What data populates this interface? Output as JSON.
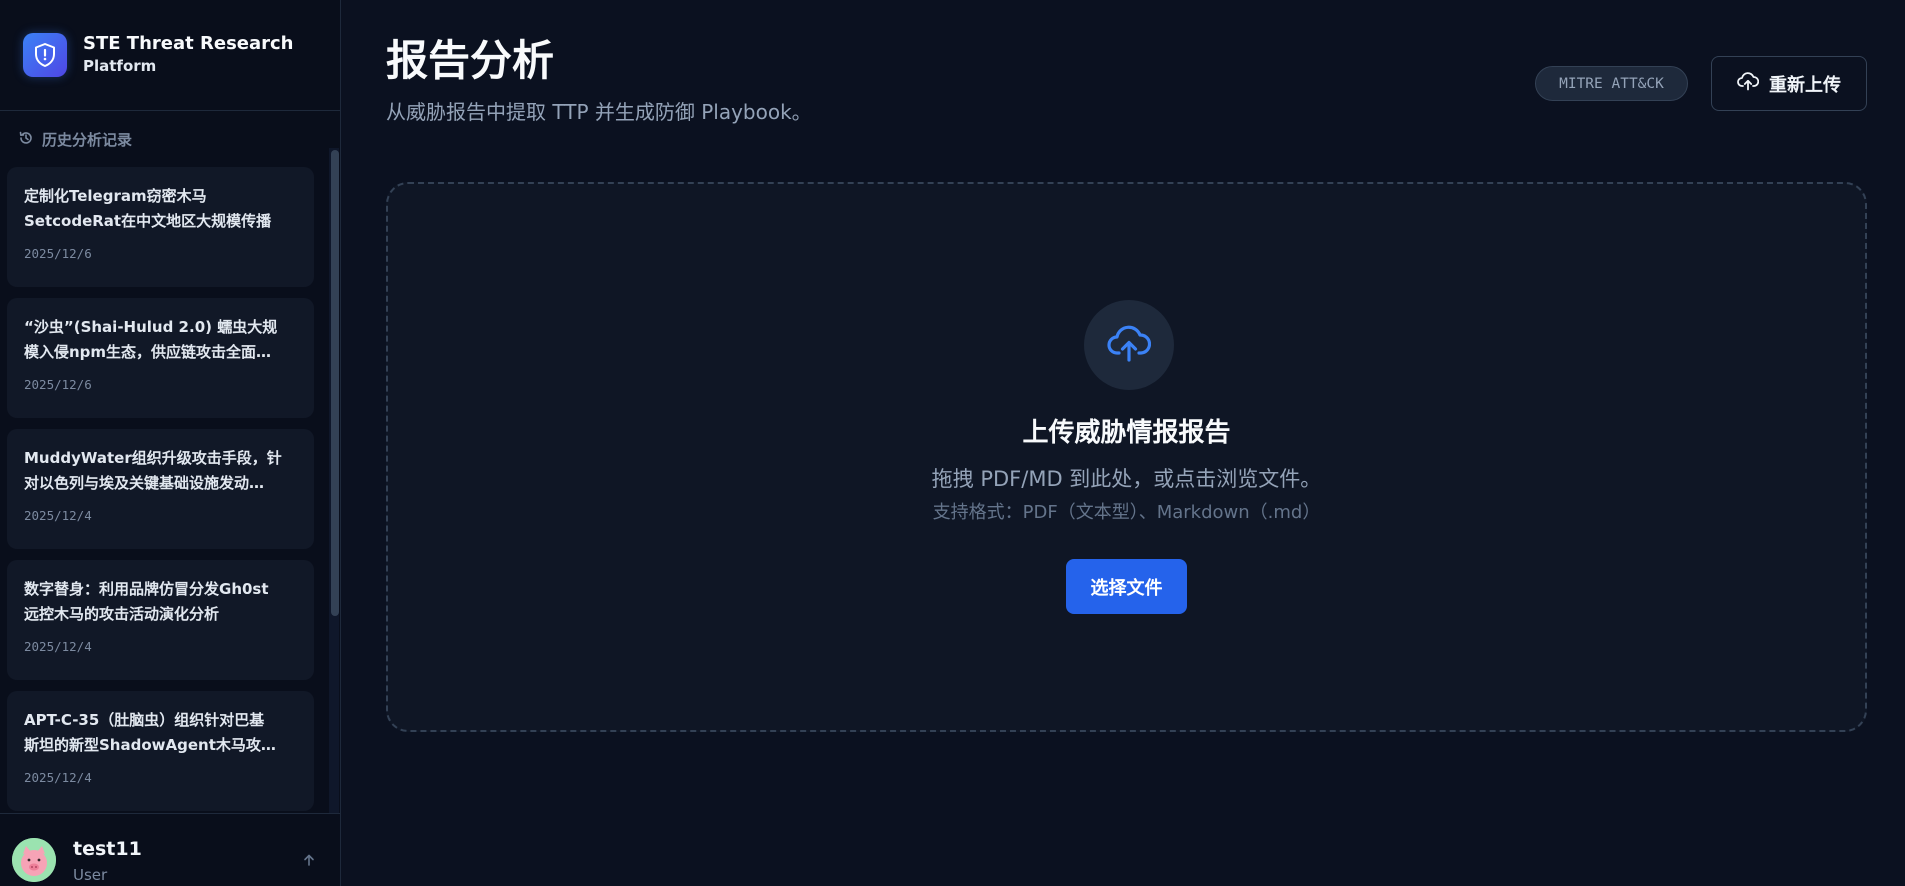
{
  "brand": {
    "title": "STE Threat Research",
    "subtitle": "Platform"
  },
  "sidebar": {
    "history_label": "历史分析记录",
    "items": [
      {
        "title_line1": "定制化Telegram窃密木马",
        "title_line2": "SetcodeRat在中文地区大规模传播",
        "date": "2025/12/6"
      },
      {
        "title_line1": "“沙虫”(Shai-Hulud 2.0) 蠕虫大规",
        "title_line2": "模入侵npm生态，供应链攻击全面…",
        "date": "2025/12/6"
      },
      {
        "title_line1": "MuddyWater组织升级攻击手段，针",
        "title_line2": "对以色列与埃及关键基础设施发动…",
        "date": "2025/12/4"
      },
      {
        "title_line1": "数字替身：利用品牌仿冒分发Gh0st",
        "title_line2": "远控木马的攻击活动演化分析",
        "date": "2025/12/4"
      },
      {
        "title_line1": "APT-C-35（肚脑虫）组织针对巴基",
        "title_line2": "斯坦的新型ShadowAgent木马攻…",
        "date": "2025/12/4"
      }
    ]
  },
  "user": {
    "name": "test11",
    "role": "User"
  },
  "header": {
    "title": "报告分析",
    "subtitle": "从威胁报告中提取 TTP 并生成防御 Playbook。",
    "badge": "MITRE ATT&CK",
    "reupload_label": "重新上传"
  },
  "dropzone": {
    "title": "上传威胁情报报告",
    "description": "拖拽 PDF/MD 到此处，或点击浏览文件。",
    "formats": "支持格式：PDF（文本型）、Markdown（.md）",
    "button_label": "选择文件"
  },
  "colors": {
    "accent": "#2563eb",
    "background": "#0b1120",
    "sidebar": "#090e1b"
  }
}
